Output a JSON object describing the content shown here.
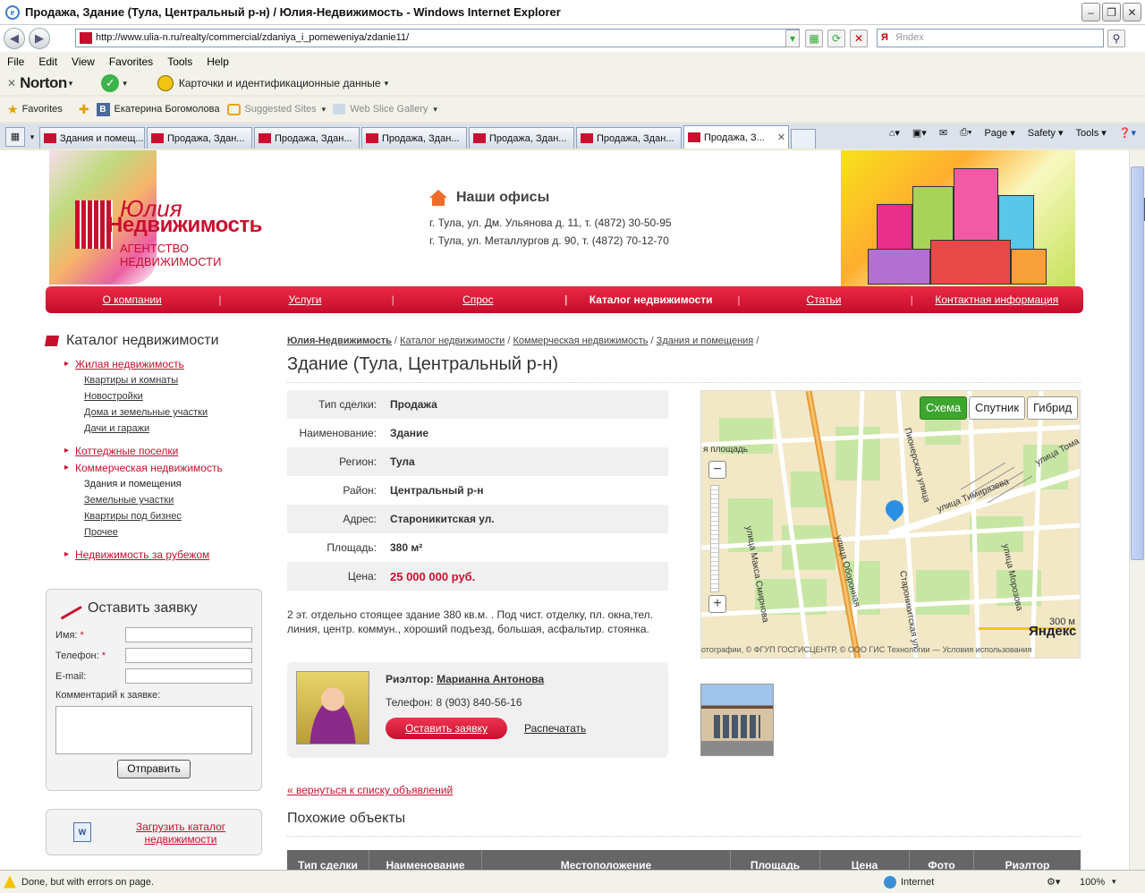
{
  "window": {
    "title": "Продажа, Здание (Тула, Центральный р-н) / Юлия-Недвижимость - Windows Internet Explorer"
  },
  "addressbar": {
    "url": "http://www.ulia-n.ru/realty/commercial/zdaniya_i_pomeweniya/zdanie11/",
    "search_placeholder": "Яndex"
  },
  "menubar": [
    "File",
    "Edit",
    "View",
    "Favorites",
    "Tools",
    "Help"
  ],
  "norton": {
    "brand": "Norton",
    "identity_label": "Карточки и идентификационные данные"
  },
  "favorites": {
    "label": "Favorites",
    "items": [
      "Екатерина Богомолова",
      "Suggested Sites",
      "Web Slice Gallery"
    ]
  },
  "tabs": [
    "Здания и помещ...",
    "Продажа, Здан...",
    "Продажа, Здан...",
    "Продажа, Здан...",
    "Продажа, Здан...",
    "Продажа, Здан...",
    "Продажа, З..."
  ],
  "tools": {
    "page": "Page",
    "safety": "Safety",
    "tools": "Tools"
  },
  "status": {
    "text": "Done, but with errors on page.",
    "zone": "Internet",
    "zoom": "100%"
  },
  "site": {
    "logo_line1": "Юлия",
    "logo_line2": "Недвижимость",
    "logo_line3": "АГЕНТСТВО НЕДВИЖИМОСТИ",
    "offices_title": "Наши офисы",
    "office1": "г. Тула, ул. Дм. Ульянова д. 11, т. (4872) 30-50-95",
    "office2": "г. Тула, ул. Металлургов д. 90, т. (4872) 70-12-70",
    "nav": [
      "О компании",
      "Услуги",
      "Спрос",
      "Каталог недвижимости",
      "Статьи",
      "Контактная информация"
    ]
  },
  "sidebar": {
    "title": "Каталог недвижимости",
    "residential": "Жилая недвижимость",
    "residential_sub": [
      "Квартиры и комнаты",
      "Новостройки",
      "Дома и земельные участки",
      "Дачи и гаражи"
    ],
    "cottage": "Коттеджные поселки",
    "commercial": "Коммерческая недвижимость",
    "commercial_sub": [
      "Здания и помещения",
      "Земельные участки",
      "Квартиры под бизнес",
      "Прочее"
    ],
    "abroad": "Недвижимость за рубежом"
  },
  "form": {
    "title": "Оставить заявку",
    "name_label": "Имя:",
    "phone_label": "Телефон:",
    "email_label": "E-mail:",
    "comment_label": "Комментарий к заявке:",
    "submit": "Отправить",
    "required_mark": "*"
  },
  "download": {
    "label": "Загрузить каталог недвижимости"
  },
  "breadcrumbs": [
    "Юлия-Недвижимость",
    "Каталог недвижимости",
    "Коммерческая недвижимость",
    "Здания и помещения"
  ],
  "listing": {
    "title": "Здание (Тула, Центральный р-н)",
    "props": [
      {
        "k": "Тип сделки:",
        "v": "Продажа"
      },
      {
        "k": "Наименование:",
        "v": "Здание"
      },
      {
        "k": "Регион:",
        "v": "Тула"
      },
      {
        "k": "Район:",
        "v": "Центральный р-н"
      },
      {
        "k": "Адрес:",
        "v": "Староникитская ул."
      },
      {
        "k": "Площадь:",
        "v": "380 м²"
      },
      {
        "k": "Цена:",
        "v": "25 000 000 руб."
      }
    ],
    "description": " 2 эт. отдельно стоящее здание 380 кв.м. .  Под чист. отделку, пл. окна,тел. линия, центр. коммун., хороший подъезд, большая, асфальтир. стоянка."
  },
  "map": {
    "btn_scheme": "Схема",
    "btn_sat": "Спутник",
    "btn_hybrid": "Гибрид",
    "scale": "300 м",
    "brand": "Яндекс",
    "copyright": "отографии, © ФГУП ГОСГИСЦЕНТР, © ООО ГИС Технологии — Условия использования",
    "streets": [
      "улица Макса Смирнова",
      "улица Оборонная",
      "Староникитская ул.",
      "Пионерская улица",
      "улица Тимирязева",
      "улица Морозова",
      "улица Тома",
      "я площадь"
    ]
  },
  "realtor": {
    "label": "Риэлтор:",
    "name": "Марианна Антонова",
    "phone": "Телефон: 8 (903) 840-56-16",
    "request_btn": "Оставить заявку",
    "print": "Распечатать"
  },
  "back_link": "« вернуться к списку объявлений",
  "similar": {
    "title": "Похожие объекты",
    "columns": [
      "Тип сделки",
      "Наименование",
      "Местоположение",
      "Площадь",
      "Цена",
      "Фото",
      "Риэлтор"
    ]
  }
}
